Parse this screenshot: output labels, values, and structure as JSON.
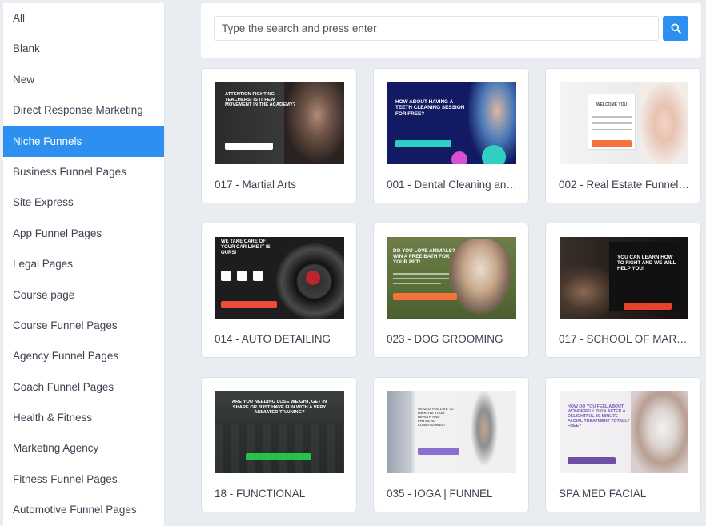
{
  "sidebar": {
    "items": [
      {
        "label": "All"
      },
      {
        "label": "Blank"
      },
      {
        "label": "New"
      },
      {
        "label": "Direct Response Marketing"
      },
      {
        "label": "Niche Funnels",
        "active": true
      },
      {
        "label": "Business Funnel Pages"
      },
      {
        "label": "Site Express"
      },
      {
        "label": "App Funnel Pages"
      },
      {
        "label": "Legal Pages"
      },
      {
        "label": "Course page"
      },
      {
        "label": "Course Funnel Pages"
      },
      {
        "label": "Agency Funnel Pages"
      },
      {
        "label": "Coach Funnel Pages"
      },
      {
        "label": "Health & Fitness"
      },
      {
        "label": "Marketing Agency"
      },
      {
        "label": "Fitness Funnel Pages"
      },
      {
        "label": "Automotive Funnel Pages"
      }
    ]
  },
  "search": {
    "placeholder": "Type the search and press enter",
    "button_icon": "search-icon"
  },
  "templates": [
    {
      "title": "017 - Martial Arts",
      "thumb_headline": "ATTENTION FIGHTING TEACHERS! IS IT FEW MOVEMENT IN THE ACADEMY?"
    },
    {
      "title": "001 - Dental Cleaning and ...",
      "thumb_headline": "HOW ABOUT HAVING A TEETH CLEANING SESSION FOR FREE?"
    },
    {
      "title": "002 - Real Estate Funnels - ...",
      "thumb_headline": "WELCOME YOU"
    },
    {
      "title": "014 - AUTO DETAILING",
      "thumb_headline": "WE TAKE CARE OF YOUR CAR LIKE IT IS OURS!"
    },
    {
      "title": "023 - DOG GROOMING",
      "thumb_headline": "DO YOU LOVE ANIMALS? WIN A FREE BATH FOR YOUR PET!"
    },
    {
      "title": "017 - SCHOOL OF MARTI...",
      "thumb_headline": "YOU CAN LEARN HOW TO FIGHT AND WE WILL HELP YOU!"
    },
    {
      "title": "18 - FUNCTIONAL",
      "thumb_headline": "ARE YOU NEEDING LOSE WEIGHT, GET IN SHAPE OR JUST HAVE FUN WITH A VERY ANIMATED TRAINING?"
    },
    {
      "title": "035 - IOGA | FUNNEL",
      "thumb_headline": "WOULD YOU LIKE TO IMPROVE YOUR HEALTH AND PHYSICAL CONDITIONING?"
    },
    {
      "title": "SPA MED FACIAL",
      "thumb_headline": "HOW DO YOU FEEL ABOUT WONDERFUL SKIN AFTER A DELIGHTFUL 30-MINUTE FACIAL TREATMENT TOTALLY FREE?"
    }
  ],
  "colors": {
    "accent": "#2d8ff0",
    "background": "#e9ecf1",
    "cta_orange": "#f5733b",
    "cta_green": "#27c24c",
    "cta_purple": "#7b5bb5"
  }
}
